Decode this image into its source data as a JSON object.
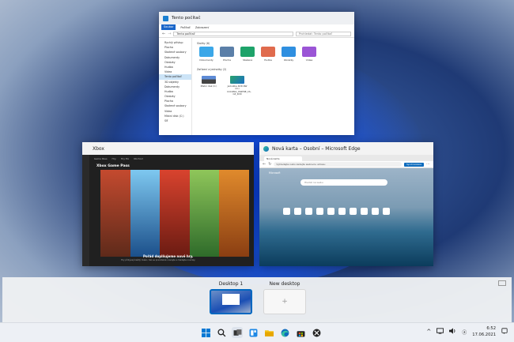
{
  "colors": {
    "accent": "#0067c0",
    "xbox_green": "#107c10"
  },
  "explorer": {
    "title": "Tento počítač",
    "ribbon": [
      "Soubor",
      "Počítač",
      "Zobrazení"
    ],
    "address": "Tento počítač",
    "search_placeholder": "Prohledat: Tento počítač",
    "sidebar": [
      "Rychlý přístup",
      "Plocha",
      "Stažené soubory",
      "Dokumenty",
      "Obrázky",
      "Hudba",
      "Videa",
      "Tento počítač",
      "3D objekty",
      "Dokumenty",
      "Hudba",
      "Obrázky",
      "Plocha",
      "Stažené soubory",
      "Videa",
      "Místní disk (C:)",
      "Síť"
    ],
    "section_folders": "Složky (6)",
    "folders": [
      {
        "label": "Dokumenty",
        "color": "#3ba7e8"
      },
      {
        "label": "Plocha",
        "color": "#5b7fa8"
      },
      {
        "label": "Stažené",
        "color": "#1ea36a"
      },
      {
        "label": "Hudba",
        "color": "#e06b4d"
      },
      {
        "label": "Obrázky",
        "color": "#2f8fe0"
      },
      {
        "label": "Videa",
        "color": "#9b55d6"
      }
    ],
    "section_drives": "Zařízení a jednotky (2)",
    "drives": [
      {
        "label": "Místní disk (C:)"
      },
      {
        "label": "Jednotka DVD RW (D:) CCCOMA_X64FRE_CS-CZ_DV9"
      }
    ]
  },
  "xbox": {
    "title": "Xbox",
    "nav": [
      "Game Pass",
      "Hry",
      "Hry EA",
      "Obchod"
    ],
    "heading": "Xbox Game Pass",
    "caption": "Pořád doplňujeme nové hry.",
    "subcaption": "Hry přibývají každý měsíc, tak se pravidelně vracejte a hledejte novinky.",
    "art_colors": [
      "#b53a2a",
      "#2b7bbd",
      "#c0392b",
      "#6aa84f",
      "#d35400"
    ]
  },
  "edge": {
    "title": "Nová karta – Osobní – Microsoft Edge",
    "tab": "Nová karta",
    "address": "Vyhledejte nebo zadejte webovou adresu",
    "button": "Synchronizace",
    "logo": "Microsoft",
    "search_placeholder": "Hledat na webu"
  },
  "desktops": {
    "current": "Desktop 1",
    "new": "New desktop",
    "new_symbol": "+"
  },
  "taskbar": {
    "icons": [
      "windows-start",
      "search",
      "task-view",
      "widgets",
      "file-explorer",
      "edge",
      "store",
      "xbox"
    ],
    "tray_chevron": "^",
    "time": "6:52",
    "date": "17.06.2021"
  }
}
